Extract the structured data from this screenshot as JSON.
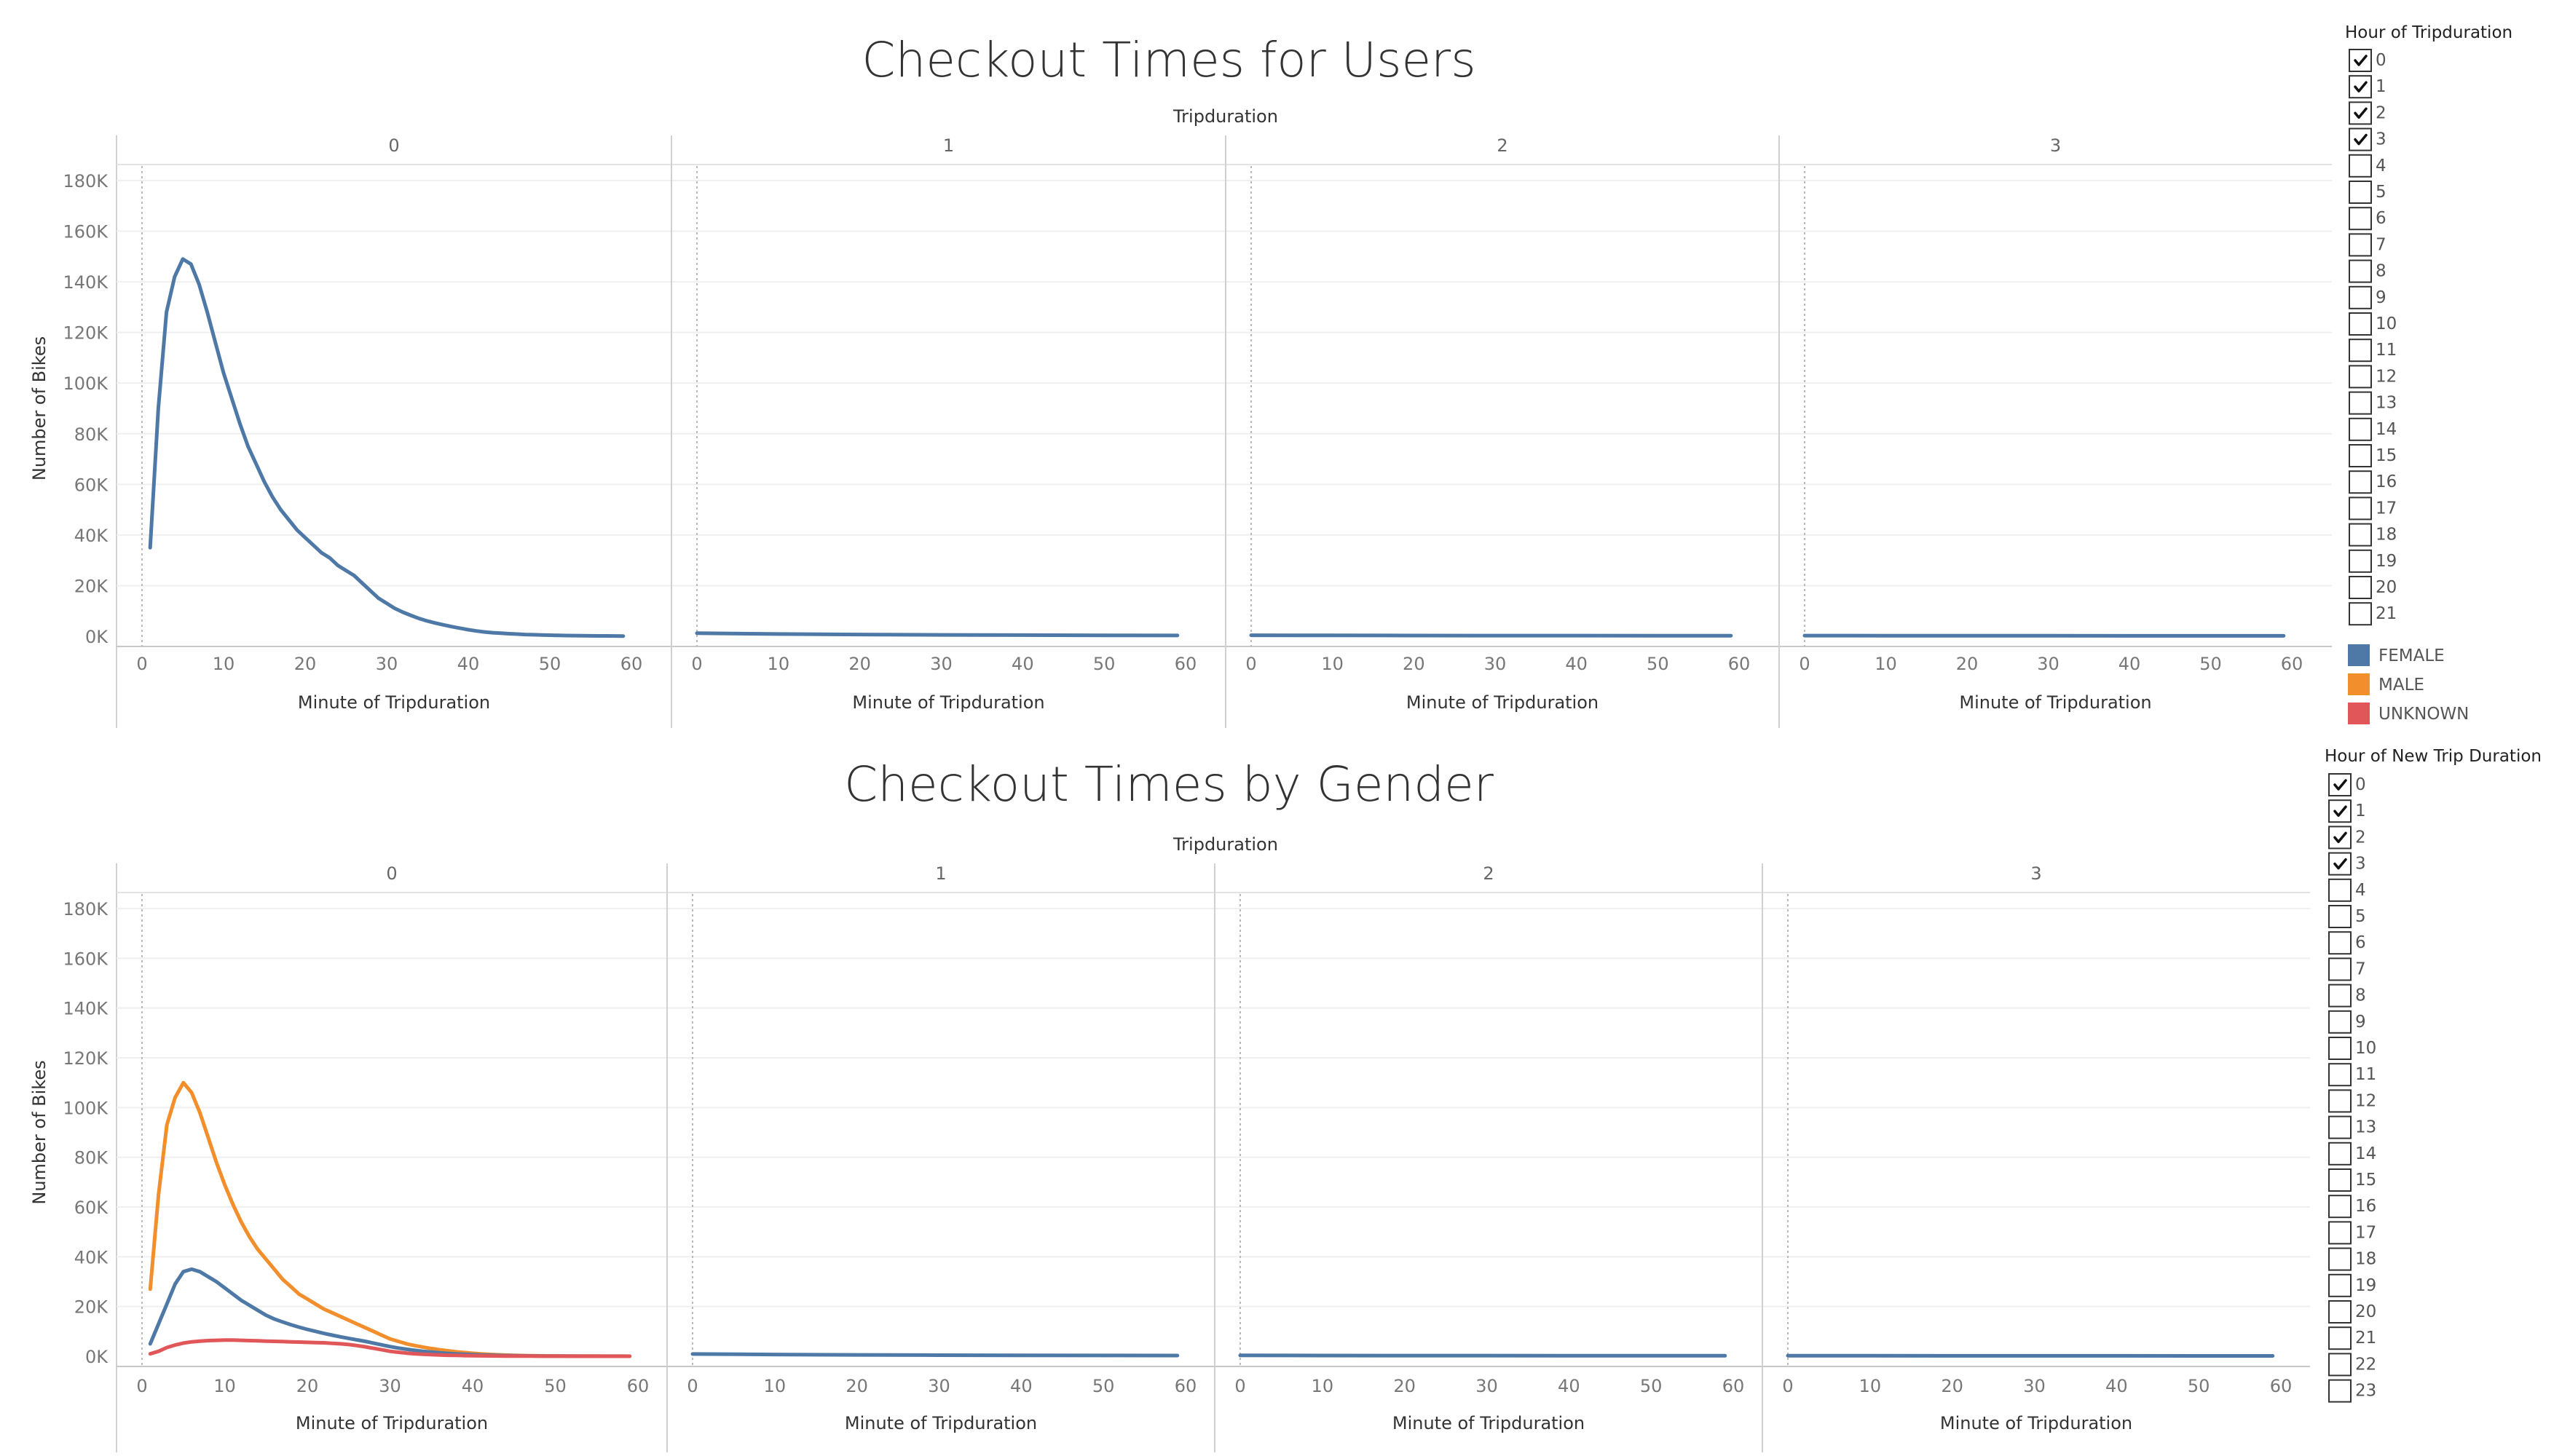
{
  "filters": [
    {
      "title": "Hour of Tripduration",
      "items": [
        "0",
        "1",
        "2",
        "3",
        "4",
        "5",
        "6",
        "7",
        "8",
        "9",
        "10",
        "11",
        "12",
        "13",
        "14",
        "15",
        "16",
        "17",
        "18",
        "19",
        "20",
        "21"
      ],
      "checked": [
        "0",
        "1",
        "2",
        "3"
      ]
    },
    {
      "title": "Hour of New Trip Duration",
      "items": [
        "0",
        "1",
        "2",
        "3",
        "4",
        "5",
        "6",
        "7",
        "8",
        "9",
        "10",
        "11",
        "12",
        "13",
        "14",
        "15",
        "16",
        "17",
        "18",
        "19",
        "20",
        "21",
        "22",
        "23"
      ],
      "checked": [
        "0",
        "1",
        "2",
        "3"
      ]
    }
  ],
  "legend": [
    {
      "label": "FEMALE",
      "color": "#4e79a7"
    },
    {
      "label": "MALE",
      "color": "#f28e2b"
    },
    {
      "label": "UNKNOWN",
      "color": "#e15759"
    }
  ],
  "chart_data": [
    {
      "type": "line",
      "title": "Checkout Times for Users",
      "column_header": "Tripduration",
      "panes": [
        "0",
        "1",
        "2",
        "3"
      ],
      "xlabel": "Minute of Tripduration",
      "ylabel": "Number of Bikes",
      "xticks": [
        0,
        10,
        20,
        30,
        40,
        50,
        60
      ],
      "yticks": [
        "0K",
        "20K",
        "40K",
        "60K",
        "80K",
        "100K",
        "120K",
        "140K",
        "160K",
        "180K"
      ],
      "ylim": [
        0,
        180000
      ],
      "xlim": [
        0,
        60
      ],
      "gridlines": true,
      "series": [
        {
          "pane": "0",
          "color": "#4e79a7",
          "x": [
            1,
            2,
            3,
            4,
            5,
            6,
            7,
            8,
            9,
            10,
            11,
            12,
            13,
            14,
            15,
            16,
            17,
            18,
            19,
            20,
            21,
            22,
            23,
            24,
            25,
            26,
            27,
            28,
            29,
            30,
            31,
            32,
            33,
            34,
            35,
            36,
            37,
            38,
            39,
            40,
            41,
            42,
            43,
            44,
            45,
            46,
            47,
            48,
            49,
            50,
            51,
            52,
            53,
            54,
            55,
            56,
            57,
            58,
            59
          ],
          "y": [
            35000,
            90000,
            128000,
            142000,
            149000,
            147000,
            139000,
            128000,
            116000,
            104000,
            94000,
            84000,
            75000,
            68000,
            61000,
            55000,
            50000,
            46000,
            42000,
            39000,
            36000,
            33000,
            31000,
            28000,
            26000,
            24000,
            21000,
            18000,
            15000,
            13000,
            11000,
            9500,
            8200,
            7000,
            6000,
            5200,
            4500,
            3800,
            3200,
            2600,
            2100,
            1700,
            1400,
            1200,
            1000,
            850,
            700,
            600,
            500,
            420,
            350,
            300,
            250,
            210,
            180,
            150,
            130,
            110,
            100
          ]
        },
        {
          "pane": "1",
          "color": "#4e79a7",
          "x": [
            0,
            10,
            20,
            30,
            40,
            50,
            59
          ],
          "y": [
            1200,
            900,
            700,
            550,
            450,
            380,
            320
          ]
        },
        {
          "pane": "2",
          "color": "#4e79a7",
          "x": [
            0,
            10,
            20,
            30,
            40,
            50,
            59
          ],
          "y": [
            400,
            350,
            300,
            270,
            250,
            230,
            220
          ]
        },
        {
          "pane": "3",
          "color": "#4e79a7",
          "x": [
            0,
            10,
            20,
            30,
            40,
            50,
            59
          ],
          "y": [
            250,
            220,
            200,
            190,
            180,
            170,
            160
          ]
        }
      ]
    },
    {
      "type": "line",
      "title": "Checkout Times by Gender",
      "column_header": "Tripduration",
      "panes": [
        "0",
        "1",
        "2",
        "3"
      ],
      "xlabel": "Minute of Tripduration",
      "ylabel": "Number of Bikes",
      "xticks": [
        0,
        10,
        20,
        30,
        40,
        50,
        60
      ],
      "yticks": [
        "0K",
        "20K",
        "40K",
        "60K",
        "80K",
        "100K",
        "120K",
        "140K",
        "160K",
        "180K"
      ],
      "ylim": [
        0,
        180000
      ],
      "xlim": [
        0,
        60
      ],
      "gridlines": true,
      "series": [
        {
          "name": "MALE",
          "pane": "0",
          "color": "#f28e2b",
          "x": [
            1,
            2,
            3,
            4,
            5,
            6,
            7,
            8,
            9,
            10,
            11,
            12,
            13,
            14,
            15,
            16,
            17,
            18,
            19,
            20,
            21,
            22,
            23,
            24,
            25,
            26,
            27,
            28,
            29,
            30,
            31,
            32,
            33,
            34,
            35,
            36,
            37,
            38,
            39,
            40,
            41,
            42,
            43,
            44,
            45,
            46,
            47,
            48,
            49,
            50,
            51,
            52,
            53,
            54,
            55,
            56,
            57,
            58,
            59
          ],
          "y": [
            27000,
            65000,
            93000,
            104000,
            110000,
            106000,
            98000,
            88000,
            78000,
            69000,
            61000,
            54000,
            48000,
            43000,
            39000,
            35000,
            31000,
            28000,
            25000,
            23000,
            21000,
            19000,
            17500,
            16000,
            14500,
            13000,
            11500,
            10000,
            8500,
            7000,
            6000,
            5000,
            4300,
            3700,
            3100,
            2600,
            2200,
            1800,
            1500,
            1200,
            950,
            750,
            600,
            480,
            380,
            300,
            240,
            190,
            150,
            120,
            100,
            80,
            65,
            55,
            45,
            38,
            32,
            27,
            23
          ]
        },
        {
          "name": "FEMALE",
          "pane": "0",
          "color": "#4e79a7",
          "x": [
            1,
            2,
            3,
            4,
            5,
            6,
            7,
            8,
            9,
            10,
            11,
            12,
            13,
            14,
            15,
            16,
            17,
            18,
            19,
            20,
            21,
            22,
            23,
            24,
            25,
            26,
            27,
            28,
            29,
            30,
            31,
            32,
            33,
            34,
            35,
            36,
            37,
            38,
            39,
            40,
            41,
            42,
            43,
            44,
            45,
            46,
            47,
            48,
            49,
            50,
            51,
            52,
            53,
            54,
            55,
            56,
            57,
            58,
            59
          ],
          "y": [
            5000,
            13000,
            21000,
            29000,
            34000,
            35000,
            34000,
            32000,
            30000,
            27500,
            25000,
            22500,
            20500,
            18500,
            16500,
            15000,
            13800,
            12700,
            11700,
            10800,
            10000,
            9200,
            8500,
            7800,
            7200,
            6600,
            6000,
            5300,
            4600,
            3900,
            3300,
            2800,
            2400,
            2000,
            1700,
            1400,
            1150,
            950,
            780,
            640,
            520,
            420,
            340,
            270,
            220,
            180,
            145,
            115,
            95,
            78,
            64,
            52,
            43,
            35,
            29,
            24,
            20,
            17,
            14
          ]
        },
        {
          "name": "UNKNOWN",
          "pane": "0",
          "color": "#e15759",
          "x": [
            1,
            2,
            3,
            4,
            5,
            6,
            7,
            8,
            9,
            10,
            11,
            12,
            13,
            14,
            15,
            16,
            17,
            18,
            19,
            20,
            21,
            22,
            23,
            24,
            25,
            26,
            27,
            28,
            29,
            30,
            31,
            32,
            33,
            34,
            35,
            36,
            37,
            38,
            39,
            40,
            41,
            42,
            43,
            44,
            45,
            46,
            47,
            48,
            49,
            50,
            51,
            52,
            53,
            54,
            55,
            56,
            57,
            58,
            59
          ],
          "y": [
            1000,
            2000,
            3500,
            4500,
            5300,
            5800,
            6100,
            6300,
            6400,
            6500,
            6500,
            6400,
            6300,
            6200,
            6100,
            6000,
            5900,
            5800,
            5700,
            5600,
            5500,
            5400,
            5200,
            5000,
            4700,
            4300,
            3800,
            3200,
            2600,
            2000,
            1600,
            1250,
            1000,
            800,
            650,
            520,
            420,
            340,
            270,
            220,
            180,
            140,
            110,
            90,
            70,
            55,
            45,
            35,
            28,
            22,
            18,
            14,
            11,
            9,
            7,
            6,
            5,
            4,
            3
          ]
        },
        {
          "name": "MALE",
          "pane": "1",
          "color": "#4e79a7",
          "x": [
            0,
            10,
            20,
            30,
            40,
            50,
            59
          ],
          "y": [
            900,
            700,
            550,
            450,
            380,
            320,
            280
          ]
        },
        {
          "name": "MALE",
          "pane": "2",
          "color": "#4e79a7",
          "x": [
            0,
            10,
            20,
            30,
            40,
            50,
            59
          ],
          "y": [
            350,
            300,
            270,
            250,
            230,
            220,
            210
          ]
        },
        {
          "name": "MALE",
          "pane": "3",
          "color": "#4e79a7",
          "x": [
            0,
            10,
            20,
            30,
            40,
            50,
            59
          ],
          "y": [
            220,
            200,
            190,
            180,
            170,
            160,
            150
          ]
        }
      ]
    }
  ]
}
